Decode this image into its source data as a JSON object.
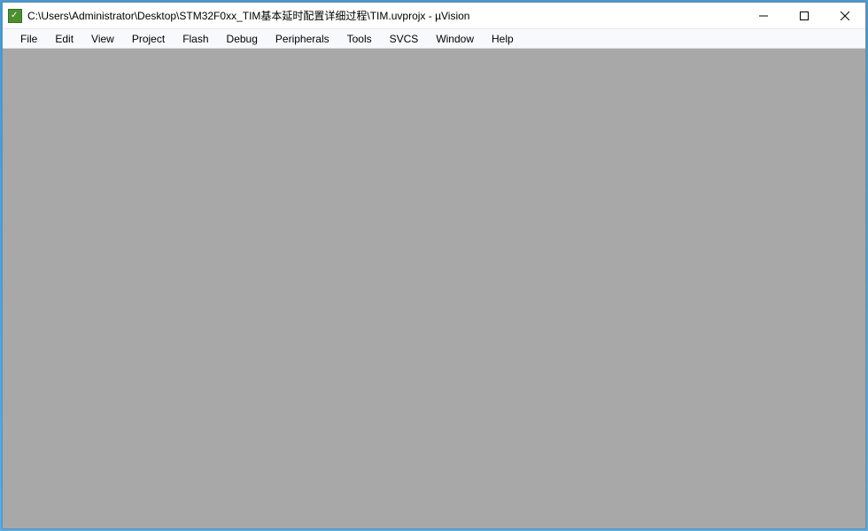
{
  "titlebar": {
    "title": "C:\\Users\\Administrator\\Desktop\\STM32F0xx_TIM基本延时配置详细过程\\TIM.uvprojx - µVision"
  },
  "menubar": {
    "items": [
      {
        "label": "File"
      },
      {
        "label": "Edit"
      },
      {
        "label": "View"
      },
      {
        "label": "Project"
      },
      {
        "label": "Flash"
      },
      {
        "label": "Debug"
      },
      {
        "label": "Peripherals"
      },
      {
        "label": "Tools"
      },
      {
        "label": "SVCS"
      },
      {
        "label": "Window"
      },
      {
        "label": "Help"
      }
    ]
  }
}
